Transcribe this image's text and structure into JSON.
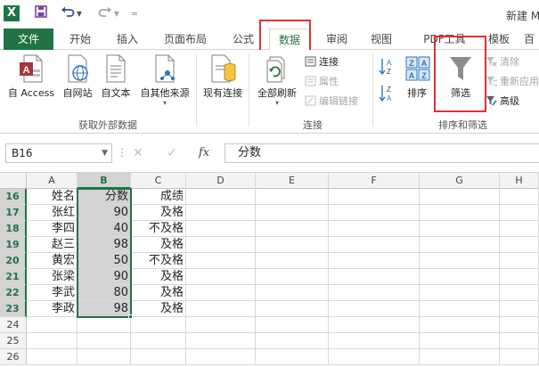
{
  "titlebar": {
    "app_logo": "X",
    "save_icon": "save-icon",
    "undo_icon": "undo-icon",
    "redo_icon": "redo-icon",
    "title": "新建 M"
  },
  "tabs": [
    {
      "label": "文件"
    },
    {
      "label": "开始"
    },
    {
      "label": "插入"
    },
    {
      "label": "页面布局"
    },
    {
      "label": "公式"
    },
    {
      "label": "数据"
    },
    {
      "label": "审阅"
    },
    {
      "label": "视图"
    },
    {
      "label": "PDF工具"
    },
    {
      "label": "模板"
    },
    {
      "label": "百"
    }
  ],
  "ribbon": {
    "get_external": {
      "label": "获取外部数据",
      "buttons": [
        "自 Access",
        "自网站",
        "自文本",
        "自其他来源"
      ]
    },
    "existing_conn": "现有连接",
    "connections": {
      "label": "连接",
      "refresh_all": "全部刷新",
      "items": [
        "连接",
        "属性",
        "编辑链接"
      ]
    },
    "sort_filter": {
      "label": "排序和筛选",
      "sort": "排序",
      "filter": "筛选",
      "az": "A Z",
      "za": "Z A",
      "side": [
        "清除",
        "重新应用",
        "高级"
      ]
    }
  },
  "formula_bar": {
    "name_box": "B16",
    "fx": "fx",
    "cancel": "✕",
    "enter": "✓",
    "content": "分数"
  },
  "grid": {
    "columns": [
      "A",
      "B",
      "C",
      "D",
      "E",
      "F",
      "G",
      "H"
    ],
    "rows": [
      {
        "num": "16",
        "a": "姓名",
        "b": "分数",
        "c": "成绩"
      },
      {
        "num": "17",
        "a": "张红",
        "b": "90",
        "c": "及格"
      },
      {
        "num": "18",
        "a": "李四",
        "b": "40",
        "c": "不及格"
      },
      {
        "num": "19",
        "a": "赵三",
        "b": "98",
        "c": "及格"
      },
      {
        "num": "20",
        "a": "黄宏",
        "b": "50",
        "c": "不及格"
      },
      {
        "num": "21",
        "a": "张梁",
        "b": "90",
        "c": "及格"
      },
      {
        "num": "22",
        "a": "李武",
        "b": "80",
        "c": "及格"
      },
      {
        "num": "23",
        "a": "李政",
        "b": "98",
        "c": "及格"
      },
      {
        "num": "24",
        "a": "",
        "b": "",
        "c": ""
      },
      {
        "num": "25",
        "a": "",
        "b": "",
        "c": ""
      },
      {
        "num": "26",
        "a": "",
        "b": "",
        "c": ""
      }
    ]
  },
  "colors": {
    "excel_green": "#217346",
    "highlight_red": "#e03232",
    "selection_gray": "#d3d3d3"
  }
}
